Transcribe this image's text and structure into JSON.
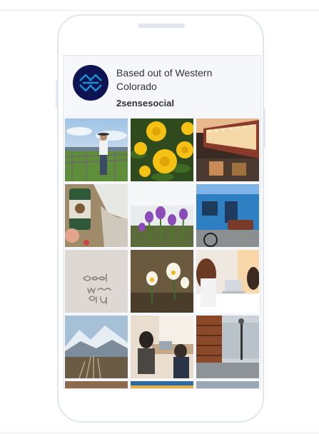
{
  "profile": {
    "bio": "Based out of Western Colorado",
    "username": "2sensesocial"
  },
  "icons": {
    "avatar": "2senses-logo-icon"
  },
  "colors": {
    "avatar_bg": "#0e1452",
    "logo_stroke": "#1a8fd6",
    "text": "#333333"
  }
}
